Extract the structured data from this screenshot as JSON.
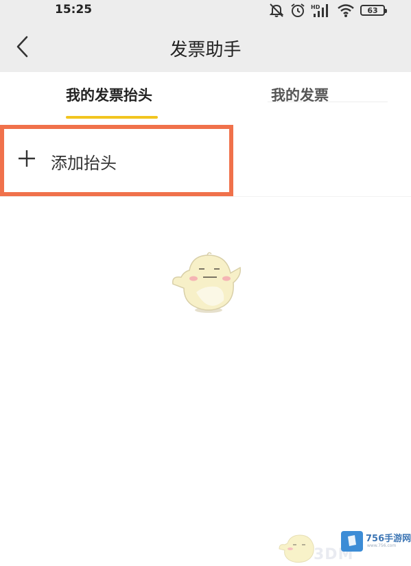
{
  "status_bar": {
    "time": "15:25",
    "signal_label": "HD",
    "battery": "63",
    "icons": [
      "mute-icon",
      "alarm-icon",
      "signal-icon",
      "wifi-icon",
      "battery-icon"
    ]
  },
  "header": {
    "title": "发票助手",
    "back_icon": "chevron-left-icon"
  },
  "tabs": [
    {
      "label": "我的发票抬头",
      "active": true
    },
    {
      "label": "我的发票",
      "active": false
    }
  ],
  "add_header": {
    "label": "添加抬头",
    "icon": "plus-icon",
    "highlight_color": "#f0714b"
  },
  "colors": {
    "accent": "#f2c51f",
    "bar_background": "#ededed"
  },
  "watermark": {
    "brand": "756手游网",
    "url": "www.756.com",
    "overlay": "3DM"
  }
}
